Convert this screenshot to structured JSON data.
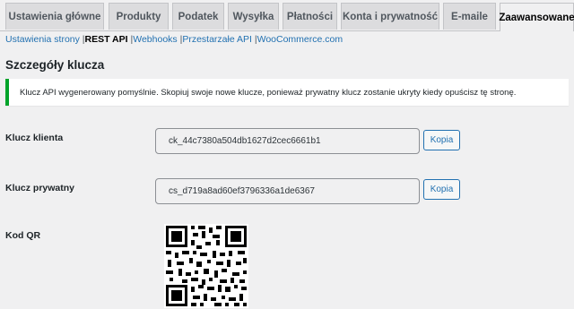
{
  "tabs": [
    {
      "label": "Ustawienia główne",
      "active": false
    },
    {
      "label": "Produkty",
      "active": false
    },
    {
      "label": "Podatek",
      "active": false
    },
    {
      "label": "Wysyłka",
      "active": false
    },
    {
      "label": "Płatności",
      "active": false
    },
    {
      "label": "Konta i prywatność",
      "active": false
    },
    {
      "label": "E-maile",
      "active": false
    },
    {
      "label": "Zaawansowane",
      "active": true
    }
  ],
  "subnav": {
    "items": [
      "Ustawienia strony",
      "REST API",
      "Webhooks",
      "Przestarzałe API",
      "WooCommerce.com"
    ],
    "separator": "|"
  },
  "section_title": "Szczegóły klucza",
  "notice": {
    "text": "Klucz API wygenerowany pomyślnie. Skopiuj swoje nowe klucze, ponieważ prywatny klucz zostanie ukryty kiedy opuścisz tę stronę.",
    "color": "#00a32a"
  },
  "fields": {
    "consumer_key": {
      "label": "Klucz klienta",
      "value": "ck_44c7380a504db1627d2cec6661b1",
      "button": "Kopia"
    },
    "consumer_secret": {
      "label": "Klucz prywatny",
      "value": "cs_d719a8ad60ef3796336a1de6367",
      "button": "Kopia"
    }
  },
  "qr": {
    "label": "Kod QR",
    "icon": "qr-code"
  }
}
